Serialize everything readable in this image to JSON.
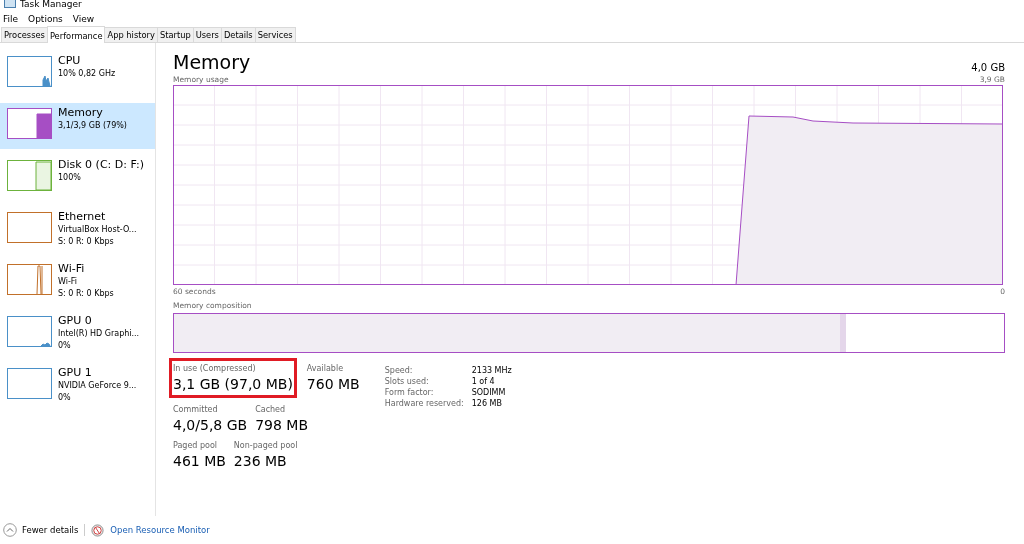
{
  "window": {
    "title": "Task Manager"
  },
  "menu": [
    "File",
    "Options",
    "View"
  ],
  "tabs": [
    {
      "label": "Processes",
      "selected": false
    },
    {
      "label": "Performance",
      "selected": true
    },
    {
      "label": "App history",
      "selected": false
    },
    {
      "label": "Startup",
      "selected": false
    },
    {
      "label": "Users",
      "selected": false
    },
    {
      "label": "Details",
      "selected": false
    },
    {
      "label": "Services",
      "selected": false
    }
  ],
  "sidebar": {
    "items": [
      {
        "name": "CPU",
        "lines": [
          "10% 0,82 GHz"
        ],
        "color": "#4a90c8",
        "selected": false,
        "kind": "cpu"
      },
      {
        "name": "Memory",
        "lines": [
          "3,1/3,9 GB (79%)"
        ],
        "color": "#a64ec4",
        "selected": true,
        "kind": "memory"
      },
      {
        "name": "Disk 0 (C: D: F:)",
        "lines": [
          "100%"
        ],
        "color": "#6cb23c",
        "selected": false,
        "kind": "disk"
      },
      {
        "name": "Ethernet",
        "lines": [
          "VirtualBox Host-O...",
          "S: 0 R: 0 Kbps"
        ],
        "color": "#c1702a",
        "selected": false,
        "kind": "flat"
      },
      {
        "name": "Wi-Fi",
        "lines": [
          "Wi-Fi",
          "S: 0 R: 0 Kbps"
        ],
        "color": "#c1702a",
        "selected": false,
        "kind": "wifi"
      },
      {
        "name": "GPU 0",
        "lines": [
          "Intel(R) HD Graphi...",
          "0%"
        ],
        "color": "#4a90c8",
        "selected": false,
        "kind": "gpu"
      },
      {
        "name": "GPU 1",
        "lines": [
          "NVIDIA GeForce 9...",
          "0%"
        ],
        "color": "#4a90c8",
        "selected": false,
        "kind": "flat"
      }
    ]
  },
  "main": {
    "title": "Memory",
    "capacity": "4,0 GB",
    "usage_label": "Memory usage",
    "usage_max": "3,9 GB",
    "time_label": "60 seconds",
    "time_end": "0",
    "composition_label": "Memory composition",
    "composition": [
      {
        "kind": "in_use",
        "level": 0.81
      }
    ],
    "stats": [
      [
        {
          "label": "In use (Compressed)",
          "value": "3,1 GB (97,0 MB)",
          "highlighted": true
        },
        {
          "label": "Available",
          "value": "760 MB",
          "highlighted": false
        }
      ],
      [
        {
          "label": "Committed",
          "value": "4,0/5,8 GB",
          "highlighted": false
        },
        {
          "label": "Cached",
          "value": "798 MB",
          "highlighted": false
        }
      ],
      [
        {
          "label": "Paged pool",
          "value": "461 MB",
          "highlighted": false
        },
        {
          "label": "Non-paged pool",
          "value": "236 MB",
          "highlighted": false
        }
      ]
    ],
    "details": [
      {
        "label": "Speed:",
        "value": "2133 MHz"
      },
      {
        "label": "Slots used:",
        "value": "1 of 4"
      },
      {
        "label": "Form factor:",
        "value": "SODIMM"
      },
      {
        "label": "Hardware reserved:",
        "value": "126 MB"
      }
    ]
  },
  "footer": {
    "fewer": "Fewer details",
    "monitor": "Open Resource Monitor"
  }
}
